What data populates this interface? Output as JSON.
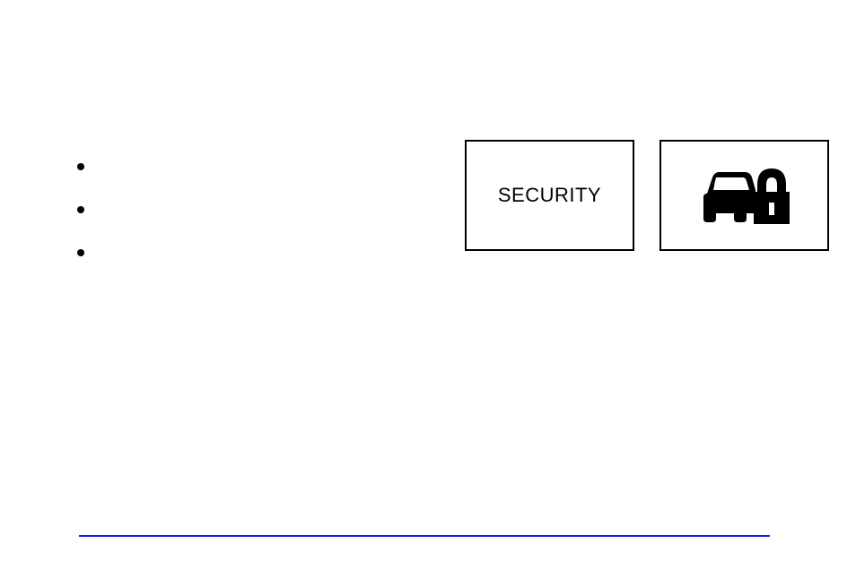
{
  "security": {
    "label": "SECURITY"
  },
  "icon": {
    "name": "car-lock"
  },
  "bullets": {
    "count": 3
  }
}
